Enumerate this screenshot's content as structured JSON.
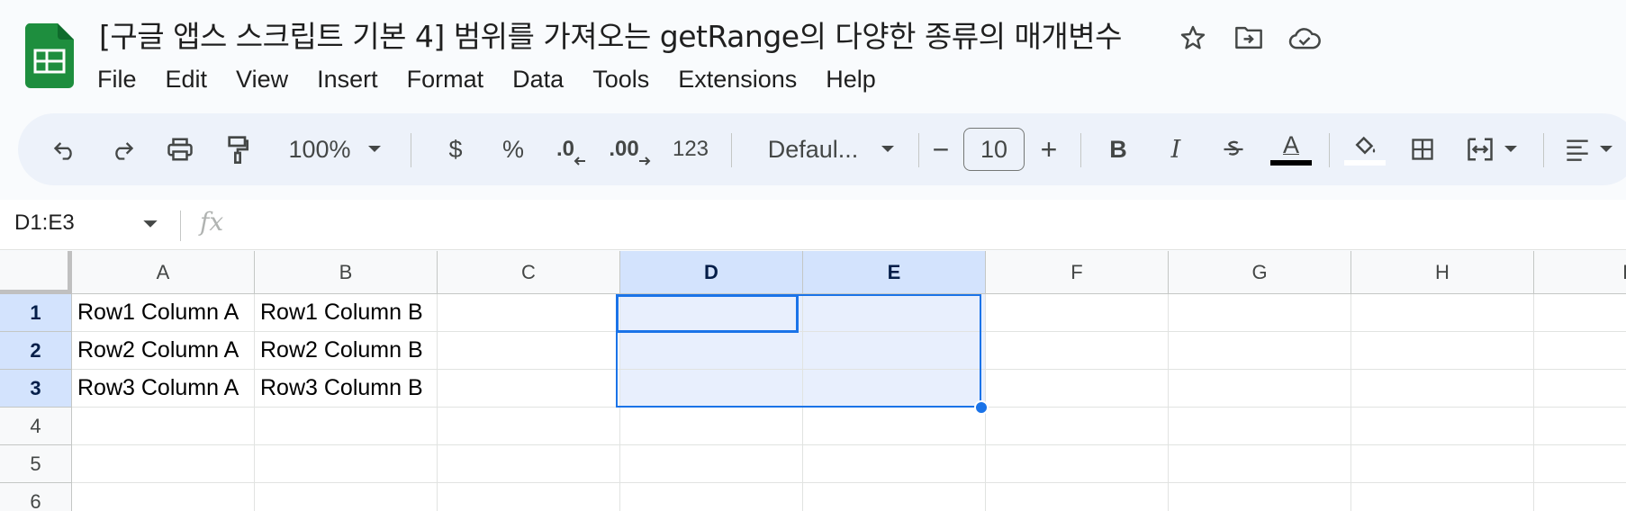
{
  "document": {
    "title": "[구글 앱스 스크립트 기본 4] 범위를 가져오는 getRange의 다양한 종류의 매개변수"
  },
  "menu": [
    "File",
    "Edit",
    "View",
    "Insert",
    "Format",
    "Data",
    "Tools",
    "Extensions",
    "Help"
  ],
  "toolbar": {
    "zoom": "100%",
    "currency": "$",
    "percent": "%",
    "decrease_decimal": ".0",
    "increase_decimal": ".00",
    "number_format": "123",
    "font": "Defaul...",
    "font_size": "10",
    "minus": "−",
    "plus": "+",
    "bold": "B",
    "italic": "I",
    "text_color": "A"
  },
  "formula_bar": {
    "name_box": "D1:E3",
    "fx": "fx"
  },
  "grid": {
    "columns": [
      "A",
      "B",
      "C",
      "D",
      "E",
      "F",
      "G",
      "H",
      "I"
    ],
    "rows": [
      "1",
      "2",
      "3",
      "4",
      "5",
      "6"
    ],
    "cells": [
      [
        "Row1 Column A",
        "Row1 Column B",
        "",
        "",
        "",
        "",
        "",
        "",
        ""
      ],
      [
        "Row2 Column A",
        "Row2 Column B",
        "",
        "",
        "",
        "",
        "",
        "",
        ""
      ],
      [
        "Row3 Column A",
        "Row3 Column B",
        "",
        "",
        "",
        "",
        "",
        "",
        ""
      ],
      [
        "",
        "",
        "",
        "",
        "",
        "",
        "",
        "",
        ""
      ],
      [
        "",
        "",
        "",
        "",
        "",
        "",
        "",
        "",
        ""
      ],
      [
        "",
        "",
        "",
        "",
        "",
        "",
        "",
        "",
        ""
      ]
    ],
    "selected_range": "D1:E3"
  },
  "colors": {
    "accent": "#1a73e8",
    "sheets_green": "#1e8e3e",
    "selection_fill": "#e8effd",
    "header_selected": "#d3e3fd"
  }
}
